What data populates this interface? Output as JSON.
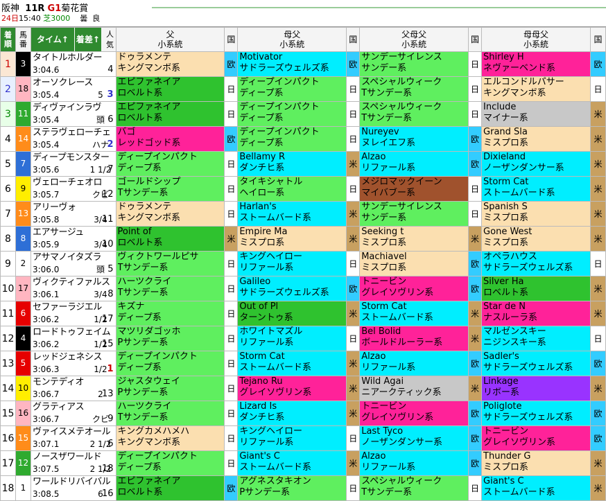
{
  "header": {
    "course": "阪神",
    "race": "11R",
    "grade": "G1",
    "name": "菊花賞",
    "date": "24日",
    "time": "15:40",
    "surface": "芝3000",
    "weather": "曇",
    "going": "良"
  },
  "columns": {
    "pos": "着順",
    "num": "馬番",
    "time": "タイム↑",
    "margin": "着差↑",
    "pop": "人気",
    "sire": "父",
    "sire_sub": "小系統",
    "country": "国",
    "bms": "母父",
    "bms_sub": "小系統",
    "sbms": "父母父",
    "sbms_sub": "小系統",
    "bbms": "母母父",
    "bbms_sub": "小系統"
  },
  "colors": {
    "eu": "#33ccff",
    "us": "#c8a060",
    "jp": "#ffffff",
    "header_green": "#2f8a2f"
  },
  "rows": [
    {
      "pos": "1",
      "num": "3",
      "numbg": "#000",
      "numfg": "#fff",
      "name": "タイトルホルダー",
      "time": "3:04.6",
      "margin": "",
      "pop": "4",
      "popc": "",
      "sire": "ドゥラメンテ",
      "sire_l": "キングマンボ系",
      "sc": "kingmambo",
      "sco": "欧",
      "sk": "eu",
      "bms": "Motivator",
      "bms_l": "サドラーズウェルズ系",
      "bc": "sadler",
      "bco": "欧",
      "bk": "eu",
      "sbms": "サンデーサイレンス",
      "sbms_l": "サンデー系",
      "tc": "tsunday",
      "tco": "日",
      "tk": "jp",
      "bbms": "Shirley H",
      "bbms_l": "ネヴァーベンド系",
      "fc": "never",
      "fco": "欧",
      "fk": "eu"
    },
    {
      "pos": "2",
      "num": "18",
      "numbg": "#ffb6c1",
      "numfg": "#000",
      "name": "オーソクレース",
      "time": "3:05.4",
      "margin": "5",
      "pop": "3",
      "popc": "p2",
      "sire": "エピファネイア",
      "sire_l": "ロベルト系",
      "sc": "roberto",
      "sco": "日",
      "sk": "jp",
      "bms": "ディープインパクト",
      "bms_l": "ディープ系",
      "bc": "deep",
      "bco": "日",
      "bk": "jp",
      "sbms": "スペシャルウィーク",
      "sbms_l": "Tサンデー系",
      "tc": "tsunday",
      "tco": "日",
      "tk": "jp",
      "bbms": "エルコンドルパサー",
      "bbms_l": "キングマンボ系",
      "fc": "kingmambo",
      "fco": "日",
      "fk": "jp"
    },
    {
      "pos": "3",
      "num": "11",
      "numbg": "#2faa2f",
      "numfg": "#fff",
      "name": "ディヴァインラヴ",
      "time": "3:05.4",
      "margin": "頭",
      "pop": "6",
      "popc": "",
      "sire": "エピファネイア",
      "sire_l": "ロベルト系",
      "sc": "roberto",
      "sco": "日",
      "sk": "jp",
      "bms": "ディープインパクト",
      "bms_l": "ディープ系",
      "bc": "deep",
      "bco": "日",
      "bk": "jp",
      "sbms": "スペシャルウィーク",
      "sbms_l": "Tサンデー系",
      "tc": "tsunday",
      "tco": "日",
      "tk": "jp",
      "bbms": "Include",
      "bbms_l": "マイナー系",
      "fc": "minor",
      "fco": "米",
      "fk": "us"
    },
    {
      "pos": "4",
      "num": "14",
      "numbg": "#ff8c1a",
      "numfg": "#fff",
      "name": "ステラヴェローチェ",
      "time": "3:05.4",
      "margin": "ハナ",
      "pop": "2",
      "popc": "p2",
      "sire": "バゴ",
      "sire_l": "レッドゴッド系",
      "sc": "redgod",
      "sco": "欧",
      "sk": "eu",
      "bms": "ディープインパクト",
      "bms_l": "ディープ系",
      "bc": "deep",
      "bco": "日",
      "bk": "jp",
      "sbms": "Nureyev",
      "sbms_l": "ヌレイエフ系",
      "tc": "nureyev",
      "tco": "欧",
      "tk": "eu",
      "bbms": "Grand Sla",
      "bbms_l": "ミスプロ系",
      "fc": "mrp",
      "fco": "米",
      "fk": "us"
    },
    {
      "pos": "5",
      "num": "7",
      "numbg": "#2e6fd6",
      "numfg": "#fff",
      "name": "ディープモンスター",
      "time": "3:05.6",
      "margin": "1 1/2",
      "pop": "7",
      "popc": "",
      "sire": "ディープインパクト",
      "sire_l": "ディープ系",
      "sc": "deep",
      "sco": "日",
      "sk": "jp",
      "bms": "Bellamy R",
      "bms_l": "ダンチヒ系",
      "bc": "danzig",
      "bco": "米",
      "bk": "us",
      "sbms": "Alzao",
      "sbms_l": "リファール系",
      "tc": "lyphard",
      "tco": "欧",
      "tk": "eu",
      "bbms": "Dixieland",
      "bbms_l": "ノーザンダンサー系",
      "fc": "nijinsky",
      "fco": "米",
      "fk": "us"
    },
    {
      "pos": "6",
      "num": "9",
      "numbg": "#ffee00",
      "numfg": "#000",
      "name": "ヴェローチェオロ",
      "time": "3:05.7",
      "margin": "クビ",
      "pop": "12",
      "popc": "",
      "sire": "ゴールドシップ",
      "sire_l": "Tサンデー系",
      "sc": "tsunday",
      "sco": "日",
      "sk": "jp",
      "bms": "タイキシャトル",
      "bms_l": "ヘイロー系",
      "bc": "deep",
      "bco": "日",
      "bk": "jp",
      "sbms": "メジロマックイーン",
      "sbms_l": "マイバブー系",
      "tc": "mahmoud",
      "tco": "日",
      "tk": "jp",
      "bbms": "Storm Cat",
      "bbms_l": "ストームバード系",
      "fc": "storm",
      "fco": "米",
      "fk": "us"
    },
    {
      "pos": "7",
      "num": "13",
      "numbg": "#ff8c1a",
      "numfg": "#fff",
      "name": "アリーヴォ",
      "time": "3:05.8",
      "margin": "3/4",
      "pop": "11",
      "popc": "",
      "sire": "ドゥラメンテ",
      "sire_l": "キングマンボ系",
      "sc": "kingmambo",
      "sco": "日",
      "sk": "jp",
      "bms": "Harlan's",
      "bms_l": "ストームバード系",
      "bc": "storm",
      "bco": "米",
      "bk": "us",
      "sbms": "サンデーサイレンス",
      "sbms_l": "サンデー系",
      "tc": "tsunday",
      "tco": "日",
      "tk": "jp",
      "bbms": "Spanish S",
      "bbms_l": "ミスプロ系",
      "fc": "mrp",
      "fco": "米",
      "fk": "us"
    },
    {
      "pos": "8",
      "num": "8",
      "numbg": "#2e6fd6",
      "numfg": "#fff",
      "name": "エアサージュ",
      "time": "3:05.9",
      "margin": "3/4",
      "pop": "10",
      "popc": "",
      "sire": "Point of",
      "sire_l": "ロベルト系",
      "sc": "roberto",
      "sco": "米",
      "sk": "us",
      "bms": "Empire Ma",
      "bms_l": "ミスプロ系",
      "bc": "mrp",
      "bco": "米",
      "bk": "us",
      "sbms": "Seeking t",
      "sbms_l": "ミスプロ系",
      "tc": "mrp",
      "tco": "米",
      "tk": "us",
      "bbms": "Gone West",
      "bbms_l": "ミスプロ系",
      "fc": "mrp",
      "fco": "米",
      "fk": "us"
    },
    {
      "pos": "9",
      "num": "2",
      "numbg": "#fff",
      "numfg": "#000",
      "name": "アサマノイタズラ",
      "time": "3:06.0",
      "margin": "頭",
      "pop": "5",
      "popc": "",
      "sire": "ヴィクトワールピサ",
      "sire_l": "Tサンデー系",
      "sc": "tsunday",
      "sco": "日",
      "sk": "jp",
      "bms": "キングヘイロー",
      "bms_l": "リファール系",
      "bc": "lyphard",
      "bco": "日",
      "bk": "jp",
      "sbms": "Machiavel",
      "sbms_l": "ミスプロ系",
      "tc": "mrp",
      "tco": "欧",
      "tk": "eu",
      "bbms": "オペラハウス",
      "bbms_l": "サドラーズウェルズ系",
      "fc": "sadler",
      "fco": "日",
      "fk": "jp"
    },
    {
      "pos": "10",
      "num": "17",
      "numbg": "#ffb6c1",
      "numfg": "#000",
      "name": "ヴィクティファルス",
      "time": "3:06.1",
      "margin": "3/4",
      "pop": "8",
      "popc": "",
      "sire": "ハーツクライ",
      "sire_l": "Tサンデー系",
      "sc": "tsunday",
      "sco": "日",
      "sk": "jp",
      "bms": "Galileo",
      "bms_l": "サドラーズウェルズ系",
      "bc": "sadler",
      "bco": "欧",
      "bk": "eu",
      "sbms": "トニービン",
      "sbms_l": "グレイソヴリン系",
      "tc": "graustark",
      "tco": "欧",
      "tk": "eu",
      "bbms": "Silver Ha",
      "bbms_l": "ロベルト系",
      "fc": "roberto",
      "fco": "米",
      "fk": "us"
    },
    {
      "pos": "11",
      "num": "6",
      "numbg": "#e60000",
      "numfg": "#fff",
      "name": "セファーラジエル",
      "time": "3:06.2",
      "margin": "1/2",
      "pop": "17",
      "popc": "",
      "sire": "キズナ",
      "sire_l": "ディープ系",
      "sc": "deep",
      "sco": "日",
      "sk": "jp",
      "bms": "Out of Pl",
      "bms_l": "ターントゥ系",
      "bc": "roberto",
      "bco": "米",
      "bk": "us",
      "sbms": "Storm Cat",
      "sbms_l": "ストームバード系",
      "tc": "storm",
      "tco": "米",
      "tk": "us",
      "bbms": "Star de N",
      "bbms_l": "ナスルーラ系",
      "fc": "naskra",
      "fco": "米",
      "fk": "us"
    },
    {
      "pos": "12",
      "num": "4",
      "numbg": "#000",
      "numfg": "#fff",
      "name": "ロードトゥフェイム",
      "time": "3:06.2",
      "margin": "1/2",
      "pop": "15",
      "popc": "",
      "sire": "マツリダゴッホ",
      "sire_l": "Pサンデー系",
      "sc": "psunday",
      "sco": "日",
      "sk": "jp",
      "bms": "ホワイトマズル",
      "bms_l": "リファール系",
      "bc": "lyphard",
      "bco": "日",
      "bk": "jp",
      "sbms": "Bel Bolid",
      "sbms_l": "ボールドルーラー系",
      "tc": "boldruler",
      "tco": "米",
      "tk": "us",
      "bbms": "マルゼンスキー",
      "bbms_l": "ニジンスキー系",
      "fc": "nijinsky",
      "fco": "日",
      "fk": "jp"
    },
    {
      "pos": "13",
      "num": "5",
      "numbg": "#e60000",
      "numfg": "#fff",
      "name": "レッドジェネシス",
      "time": "3:06.3",
      "margin": "1/2",
      "pop": "1",
      "popc": "p1",
      "sire": "ディープインパクト",
      "sire_l": "ディープ系",
      "sc": "deep",
      "sco": "日",
      "sk": "jp",
      "bms": "Storm Cat",
      "bms_l": "ストームバード系",
      "bc": "storm",
      "bco": "米",
      "bk": "us",
      "sbms": "Alzao",
      "sbms_l": "リファール系",
      "tc": "lyphard",
      "tco": "欧",
      "tk": "eu",
      "bbms": "Sadler's",
      "bbms_l": "サドラーズウェルズ系",
      "fc": "sadler",
      "fco": "欧",
      "fk": "eu"
    },
    {
      "pos": "14",
      "num": "10",
      "numbg": "#ffee00",
      "numfg": "#000",
      "name": "モンテディオ",
      "time": "3:06.7",
      "margin": "2",
      "pop": "13",
      "popc": "",
      "sire": "ジャスタウェイ",
      "sire_l": "Pサンデー系",
      "sc": "psunday",
      "sco": "日",
      "sk": "jp",
      "bms": "Tejano Ru",
      "bms_l": "グレイソヴリン系",
      "bc": "graustark",
      "bco": "米",
      "bk": "us",
      "sbms": "Wild Agai",
      "sbms_l": "ニアークティック系",
      "tc": "nearctic",
      "tco": "米",
      "tk": "us",
      "bbms": "Linkage",
      "bbms_l": "リボー系",
      "fc": "ribot",
      "fco": "米",
      "fk": "us"
    },
    {
      "pos": "15",
      "num": "16",
      "numbg": "#ffb6c1",
      "numfg": "#000",
      "name": "グラティアス",
      "time": "3:06.7",
      "margin": "クビ",
      "pop": "9",
      "popc": "",
      "sire": "ハーツクライ",
      "sire_l": "Tサンデー系",
      "sc": "tsunday",
      "sco": "日",
      "sk": "jp",
      "bms": "Lizard Is",
      "bms_l": "ダンチヒ系",
      "bc": "danzig",
      "bco": "米",
      "bk": "us",
      "sbms": "トニービン",
      "sbms_l": "グレイソヴリン系",
      "tc": "graustark",
      "tco": "欧",
      "tk": "eu",
      "bbms": "Poliglote",
      "bbms_l": "サドラーズウェルズ系",
      "fc": "sadler",
      "fco": "欧",
      "fk": "eu"
    },
    {
      "pos": "16",
      "num": "15",
      "numbg": "#ff8c1a",
      "numfg": "#fff",
      "name": "ヴァイスメテオール",
      "time": "3:07.1",
      "margin": "2 1/2",
      "pop": "6",
      "popc": "",
      "sire": "キングカメハメハ",
      "sire_l": "キングマンボ系",
      "sc": "kingmambo",
      "sco": "日",
      "sk": "jp",
      "bms": "キングヘイロー",
      "bms_l": "リファール系",
      "bc": "lyphard",
      "bco": "日",
      "bk": "jp",
      "sbms": "Last Tyco",
      "sbms_l": "ノーザンダンサー系",
      "tc": "nijinsky",
      "tco": "欧",
      "tk": "eu",
      "bbms": "トニービン",
      "bbms_l": "グレイソヴリン系",
      "fc": "graustark",
      "fco": "欧",
      "fk": "eu"
    },
    {
      "pos": "17",
      "num": "12",
      "numbg": "#2faa2f",
      "numfg": "#fff",
      "name": "ノースザワールド",
      "time": "3:07.5",
      "margin": "2 1/2",
      "pop": "18",
      "popc": "",
      "sire": "ディープインパクト",
      "sire_l": "ディープ系",
      "sc": "deep",
      "sco": "日",
      "sk": "jp",
      "bms": "Giant's C",
      "bms_l": "ストームバード系",
      "bc": "storm",
      "bco": "米",
      "bk": "us",
      "sbms": "Alzao",
      "sbms_l": "リファール系",
      "tc": "lyphard",
      "tco": "欧",
      "tk": "eu",
      "bbms": "Thunder G",
      "bbms_l": "ミスプロ系",
      "fc": "mrp",
      "fco": "米",
      "fk": "us"
    },
    {
      "pos": "18",
      "num": "1",
      "numbg": "#fff",
      "numfg": "#000",
      "name": "ワールドリバイバル",
      "time": "3:08.5",
      "margin": "6",
      "pop": "16",
      "popc": "",
      "sire": "エピファネイア",
      "sire_l": "ロベルト系",
      "sc": "roberto",
      "sco": "欧",
      "sk": "eu",
      "bms": "アグネスタキオン",
      "bms_l": "Pサンデー系",
      "bc": "psunday",
      "bco": "日",
      "bk": "jp",
      "sbms": "スペシャルウィーク",
      "sbms_l": "Tサンデー系",
      "tc": "tsunday",
      "tco": "日",
      "tk": "jp",
      "bbms": "Giant's C",
      "bbms_l": "ストームバード系",
      "fc": "storm",
      "fco": "米",
      "fk": "us"
    }
  ]
}
